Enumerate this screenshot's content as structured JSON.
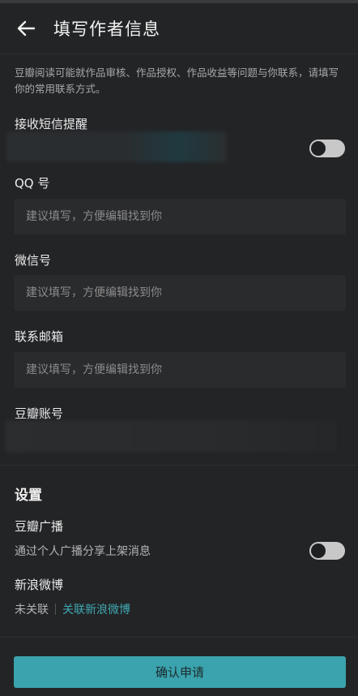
{
  "header": {
    "title": "填写作者信息",
    "back_icon": "arrow-left-icon"
  },
  "intro": "豆瓣阅读可能就作品审核、作品授权、作品收益等问题与你联系，请填写你的常用联系方式。",
  "sms": {
    "label": "接收短信提醒",
    "enabled": false
  },
  "qq": {
    "label": "QQ 号",
    "placeholder": "建议填写，方便编辑找到你",
    "value": ""
  },
  "wechat": {
    "label": "微信号",
    "placeholder": "建议填写，方便编辑找到你",
    "value": ""
  },
  "email": {
    "label": "联系邮箱",
    "placeholder": "建议填写，方便编辑找到你",
    "value": ""
  },
  "douban_account": {
    "label": "豆瓣账号"
  },
  "settings": {
    "title": "设置",
    "broadcast": {
      "label": "豆瓣广播",
      "description": "通过个人广播分享上架消息",
      "enabled": false
    },
    "weibo": {
      "label": "新浪微博",
      "status": "未关联",
      "link": "关联新浪微博"
    }
  },
  "confirm_label": "确认申请",
  "colors": {
    "accent": "#3aa3ad",
    "background": "#232426",
    "field": "#2a2b2d"
  }
}
